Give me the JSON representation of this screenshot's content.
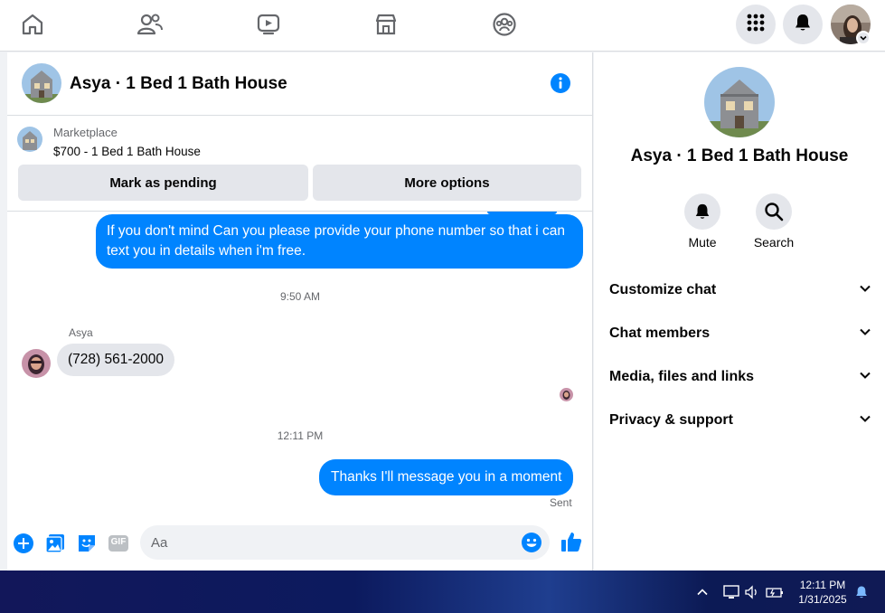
{
  "colors": {
    "accent": "#0084ff",
    "gray_bg": "#e4e6eb",
    "secondary_text": "#65676b"
  },
  "topnav": {
    "icons": [
      "home-icon",
      "friends-icon",
      "watch-icon",
      "marketplace-icon",
      "groups-icon"
    ],
    "right": [
      "menu-grid-icon",
      "bell-icon"
    ]
  },
  "chat": {
    "title": "Asya · 1 Bed 1 Bath House",
    "marketplace": {
      "label": "Marketplace",
      "item": "$700 - 1 Bed 1 Bath House",
      "pending_button": "Mark as pending",
      "more_button": "More options"
    },
    "messages": {
      "out1": "If you don't mind Can you please provide your phone number so that i can text you in details when i'm free.",
      "ts1": "9:50 AM",
      "sender": "Asya",
      "in1": "(728) 561-2000",
      "ts2": "12:11 PM",
      "out2": "Thanks I'll message you in a moment",
      "status": "Sent"
    },
    "composer": {
      "placeholder": "Aa",
      "gif_label": "GIF"
    }
  },
  "sidebar": {
    "title": "Asya · 1 Bed 1 Bath House",
    "mute": "Mute",
    "search": "Search",
    "sections": [
      "Customize chat",
      "Chat members",
      "Media, files and links",
      "Privacy & support"
    ]
  },
  "taskbar": {
    "time": "12:11 PM",
    "date": "1/31/2025"
  }
}
